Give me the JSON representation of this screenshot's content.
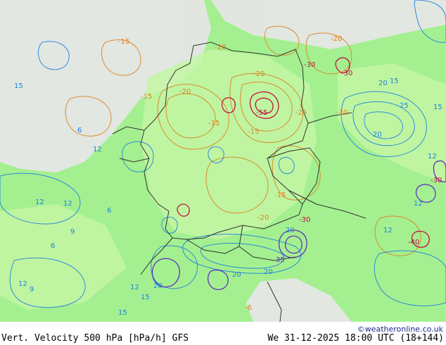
{
  "map": {
    "title": "Vert. Velocity 500 hPa [hPa/h] GFS",
    "datetime": "We 31-12-2025 18:00 UTC (18+144)",
    "credit": "©weatheronline.co.uk",
    "colors": {
      "background": "#a4f090",
      "light_region": "#e8e8e8",
      "land_bright": "#c0f8a0",
      "border": "#333333",
      "negative_contour": "#e08020",
      "strong_negative_contour": "#c01040",
      "positive_contour": "#2080e0",
      "strong_positive_contour": "#6030c0"
    },
    "contour_labels": [
      {
        "text": "-20",
        "color": "#e08020"
      },
      {
        "text": "-15",
        "color": "#e08020"
      },
      {
        "text": "-20",
        "color": "#e08020"
      },
      {
        "text": "-30",
        "color": "#c01040"
      },
      {
        "text": "-30",
        "color": "#c01040"
      },
      {
        "text": "20",
        "color": "#2080e0"
      },
      {
        "text": "15",
        "color": "#2080e0"
      },
      {
        "text": "-20",
        "color": "#e08020"
      },
      {
        "text": "-15",
        "color": "#e08020"
      },
      {
        "text": "-55",
        "color": "#c01040"
      },
      {
        "text": "-25",
        "color": "#e08020"
      },
      {
        "text": "-20",
        "color": "#e08020"
      },
      {
        "text": "-15",
        "color": "#e08020"
      },
      {
        "text": "-15",
        "color": "#e08020"
      },
      {
        "text": "20",
        "color": "#2080e0"
      },
      {
        "text": "25",
        "color": "#2080e0"
      },
      {
        "text": "15",
        "color": "#2080e0"
      },
      {
        "text": "12",
        "color": "#2080e0"
      },
      {
        "text": "6",
        "color": "#2080e0"
      },
      {
        "text": "12",
        "color": "#2080e0"
      },
      {
        "text": "12",
        "color": "#2080e0"
      },
      {
        "text": "-30",
        "color": "#c01040"
      },
      {
        "text": "12",
        "color": "#2080e0"
      },
      {
        "text": "-20",
        "color": "#e08020"
      },
      {
        "text": "-30",
        "color": "#c01040"
      },
      {
        "text": "12",
        "color": "#2080e0"
      },
      {
        "text": "-40",
        "color": "#c01040"
      },
      {
        "text": "20",
        "color": "#2080e0"
      },
      {
        "text": "35",
        "color": "#6030c0"
      },
      {
        "text": "20",
        "color": "#2080e0"
      },
      {
        "text": "20",
        "color": "#2080e0"
      },
      {
        "text": "20",
        "color": "#2080e0"
      },
      {
        "text": "12",
        "color": "#2080e0"
      },
      {
        "text": "15",
        "color": "#2080e0"
      },
      {
        "text": "12",
        "color": "#2080e0"
      },
      {
        "text": "9",
        "color": "#2080e0"
      },
      {
        "text": "15",
        "color": "#2080e0"
      },
      {
        "text": "-6",
        "color": "#e08020"
      },
      {
        "text": "6",
        "color": "#2080e0"
      },
      {
        "text": "9",
        "color": "#2080e0"
      },
      {
        "text": "6",
        "color": "#2080e0"
      },
      {
        "text": "12",
        "color": "#2080e0"
      },
      {
        "text": "-15",
        "color": "#e08020"
      },
      {
        "text": "-20",
        "color": "#e08020"
      },
      {
        "text": "15",
        "color": "#2080e0"
      }
    ]
  }
}
